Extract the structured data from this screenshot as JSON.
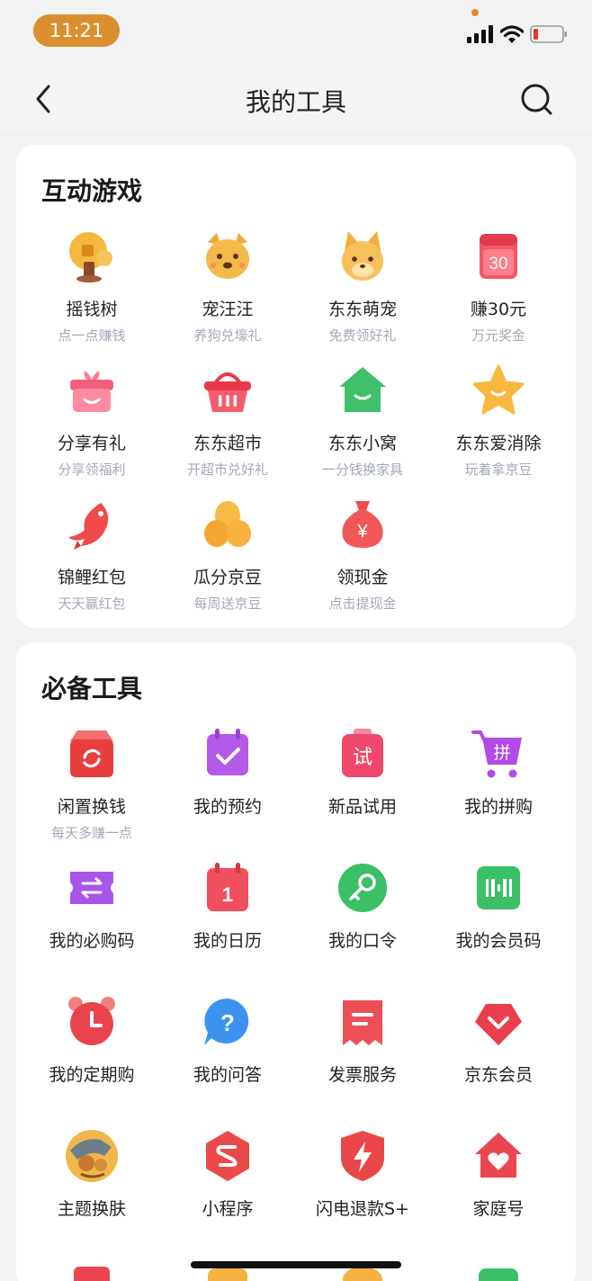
{
  "status_bar": {
    "time": "11:21"
  },
  "nav": {
    "title": "我的工具"
  },
  "games": {
    "title": "互动游戏",
    "items": [
      {
        "label": "摇钱树",
        "sub": "点一点赚钱",
        "icon": "money-tree-icon"
      },
      {
        "label": "宠汪汪",
        "sub": "养狗兑壕礼",
        "icon": "dog-icon"
      },
      {
        "label": "东东萌宠",
        "sub": "免费领好礼",
        "icon": "pet-icon"
      },
      {
        "label": "赚30元",
        "sub": "万元奖金",
        "icon": "calendar-30-icon",
        "badge": "30"
      },
      {
        "label": "分享有礼",
        "sub": "分享领福利",
        "icon": "gift-box-icon"
      },
      {
        "label": "东东超市",
        "sub": "开超市兑好礼",
        "icon": "basket-icon"
      },
      {
        "label": "东东小窝",
        "sub": "一分钱换家具",
        "icon": "house-icon"
      },
      {
        "label": "东东爱消除",
        "sub": "玩着拿京豆",
        "icon": "star-icon"
      },
      {
        "label": "锦鲤红包",
        "sub": "天天赢红包",
        "icon": "koi-icon"
      },
      {
        "label": "瓜分京豆",
        "sub": "每周送京豆",
        "icon": "beans-icon"
      },
      {
        "label": "领现金",
        "sub": "点击提现金",
        "icon": "money-bag-icon",
        "badge": "¥"
      }
    ]
  },
  "tools": {
    "title": "必备工具",
    "items": [
      {
        "label": "闲置换钱",
        "sub": "每天多赚一点",
        "icon": "recycle-box-icon"
      },
      {
        "label": "我的预约",
        "sub": "",
        "icon": "calendar-check-icon"
      },
      {
        "label": "新品试用",
        "sub": "",
        "icon": "trial-icon",
        "badge": "试"
      },
      {
        "label": "我的拼购",
        "sub": "",
        "icon": "cart-icon",
        "badge": "拼"
      },
      {
        "label": "我的必购码",
        "sub": "",
        "icon": "ticket-icon"
      },
      {
        "label": "我的日历",
        "sub": "",
        "icon": "calendar-icon",
        "badge": "1"
      },
      {
        "label": "我的口令",
        "sub": "",
        "icon": "key-icon"
      },
      {
        "label": "我的会员码",
        "sub": "",
        "icon": "barcode-icon"
      },
      {
        "label": "我的定期购",
        "sub": "",
        "icon": "alarm-clock-icon"
      },
      {
        "label": "我的问答",
        "sub": "",
        "icon": "question-bubble-icon",
        "badge": "?"
      },
      {
        "label": "发票服务",
        "sub": "",
        "icon": "invoice-icon"
      },
      {
        "label": "京东会员",
        "sub": "",
        "icon": "heart-badge-icon"
      },
      {
        "label": "主题换肤",
        "sub": "",
        "icon": "theme-avatar-icon"
      },
      {
        "label": "小程序",
        "sub": "",
        "icon": "mini-program-icon"
      },
      {
        "label": "闪电退款S+",
        "sub": "",
        "icon": "lightning-shield-icon"
      },
      {
        "label": "家庭号",
        "sub": "",
        "icon": "family-house-icon"
      }
    ]
  },
  "colors": {
    "accent_red": "#e83e3e",
    "time_pill": "#d98f2e",
    "sub_text": "#a3a8b8"
  }
}
